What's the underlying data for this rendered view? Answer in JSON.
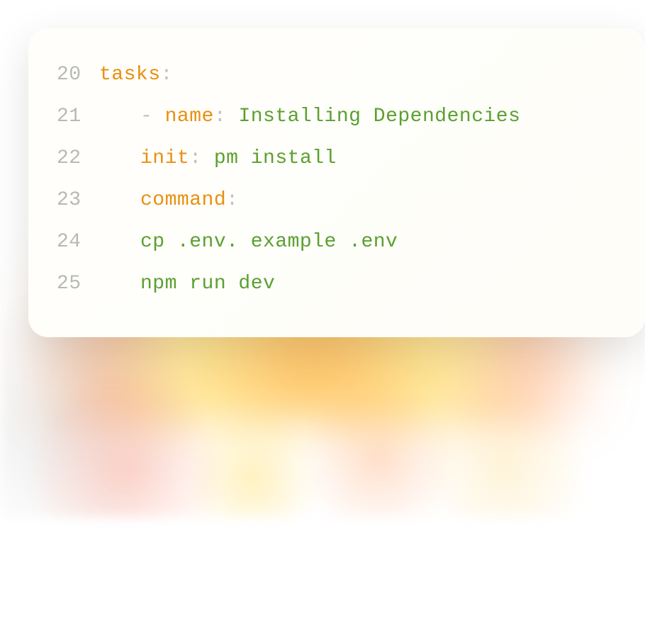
{
  "code": {
    "lines": [
      {
        "number": "20",
        "indent": 1,
        "segments": [
          {
            "type": "key",
            "text": "tasks"
          },
          {
            "type": "colon",
            "text": ":"
          }
        ]
      },
      {
        "number": "21",
        "indent": 2,
        "segments": [
          {
            "type": "dash",
            "text": "- "
          },
          {
            "type": "key",
            "text": "name"
          },
          {
            "type": "colon",
            "text": ": "
          },
          {
            "type": "value",
            "text": "Installing Dependencies"
          }
        ]
      },
      {
        "number": "22",
        "indent": 3,
        "segments": [
          {
            "type": "key",
            "text": "init"
          },
          {
            "type": "colon",
            "text": ": "
          },
          {
            "type": "value",
            "text": "pm install"
          }
        ]
      },
      {
        "number": "23",
        "indent": 3,
        "segments": [
          {
            "type": "key",
            "text": "command"
          },
          {
            "type": "colon",
            "text": ":"
          }
        ]
      },
      {
        "number": "24",
        "indent": 3,
        "segments": [
          {
            "type": "value",
            "text": "cp .env. example .env"
          }
        ]
      },
      {
        "number": "25",
        "indent": 3,
        "segments": [
          {
            "type": "value",
            "text": "npm run dev"
          }
        ]
      }
    ]
  },
  "colors": {
    "key": "#e89010",
    "value": "#5ba030",
    "lineNumber": "#b8b8b8",
    "punctuation": "#c0c0c0",
    "cardBackground": "#fffefb"
  }
}
